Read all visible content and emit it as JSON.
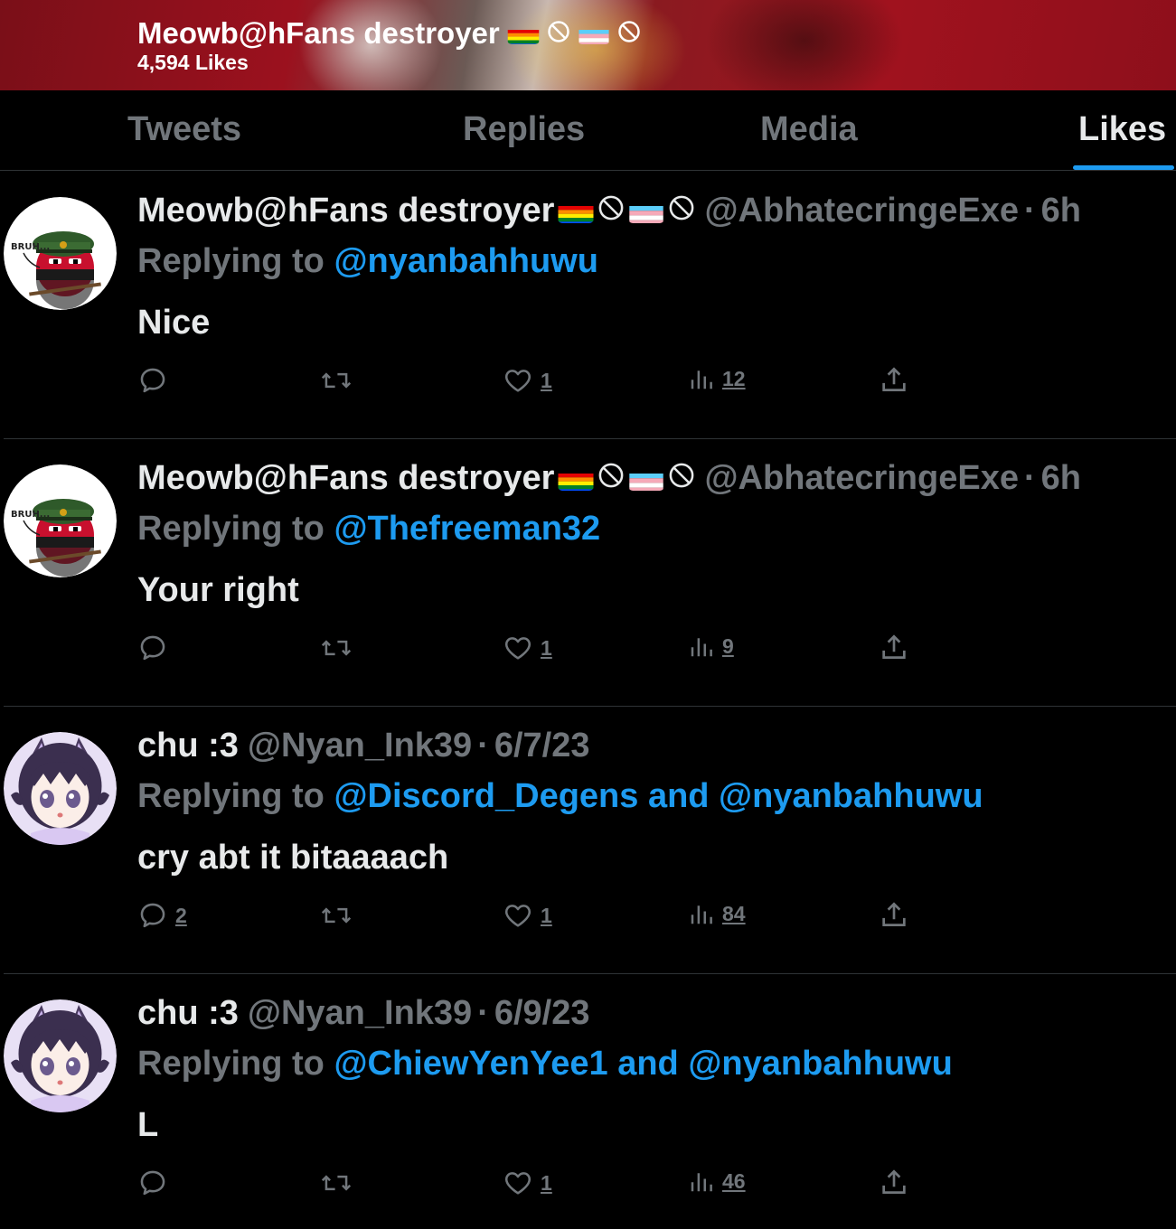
{
  "header": {
    "name": "Meowb@hFans destroyer",
    "likes_count": "4,594 Likes"
  },
  "tabs": [
    {
      "label": "Tweets",
      "active": false
    },
    {
      "label": "Replies",
      "active": false
    },
    {
      "label": "Media",
      "active": false
    },
    {
      "label": "Likes",
      "active": true
    }
  ],
  "colors": {
    "accent": "#1d9bf0",
    "muted": "#71767b",
    "text": "#e7e9ea",
    "background": "#000000",
    "header_red": "#9b111e"
  },
  "tweets": [
    {
      "display_name": "Meowb@hFans destroyer",
      "has_flag_icons": true,
      "handle": "@AbhatecringeExe",
      "dot": "·",
      "time": "6h",
      "replying_prefix": "Replying to",
      "replying_mentions": "@nyanbahhuwu",
      "text": "Nice",
      "avatar": "countryball-avatar",
      "counts": {
        "reply": "",
        "retweet": "",
        "like": "1",
        "views": "12"
      }
    },
    {
      "display_name": "Meowb@hFans destroyer",
      "has_flag_icons": true,
      "handle": "@AbhatecringeExe",
      "dot": "·",
      "time": "6h",
      "replying_prefix": "Replying to",
      "replying_mentions": "@Thefreeman32",
      "text": "Your right",
      "avatar": "countryball-avatar",
      "counts": {
        "reply": "",
        "retweet": "",
        "like": "1",
        "views": "9"
      }
    },
    {
      "display_name": "chu :3",
      "has_flag_icons": false,
      "handle": "@Nyan_Ink39",
      "dot": "·",
      "time": "6/7/23",
      "replying_prefix": "Replying to",
      "replying_mentions": "@Discord_Degens and @nyanbahhuwu",
      "text": "cry abt it bitaaaach",
      "avatar": "anime-girl-avatar",
      "counts": {
        "reply": "2",
        "retweet": "",
        "like": "1",
        "views": "84"
      }
    },
    {
      "display_name": "chu :3",
      "has_flag_icons": false,
      "handle": "@Nyan_Ink39",
      "dot": "·",
      "time": "6/9/23",
      "replying_prefix": "Replying to",
      "replying_mentions": "@ChiewYenYee1 and @nyanbahhuwu",
      "text": "L",
      "avatar": "anime-girl-avatar",
      "counts": {
        "reply": "",
        "retweet": "",
        "like": "1",
        "views": "46"
      }
    }
  ],
  "icons": {
    "reply": "reply-icon",
    "retweet": "retweet-icon",
    "like": "heart-icon",
    "views": "views-icon",
    "share": "share-icon"
  },
  "avatar_texts": {
    "countryball_caption": "BRUH..."
  }
}
